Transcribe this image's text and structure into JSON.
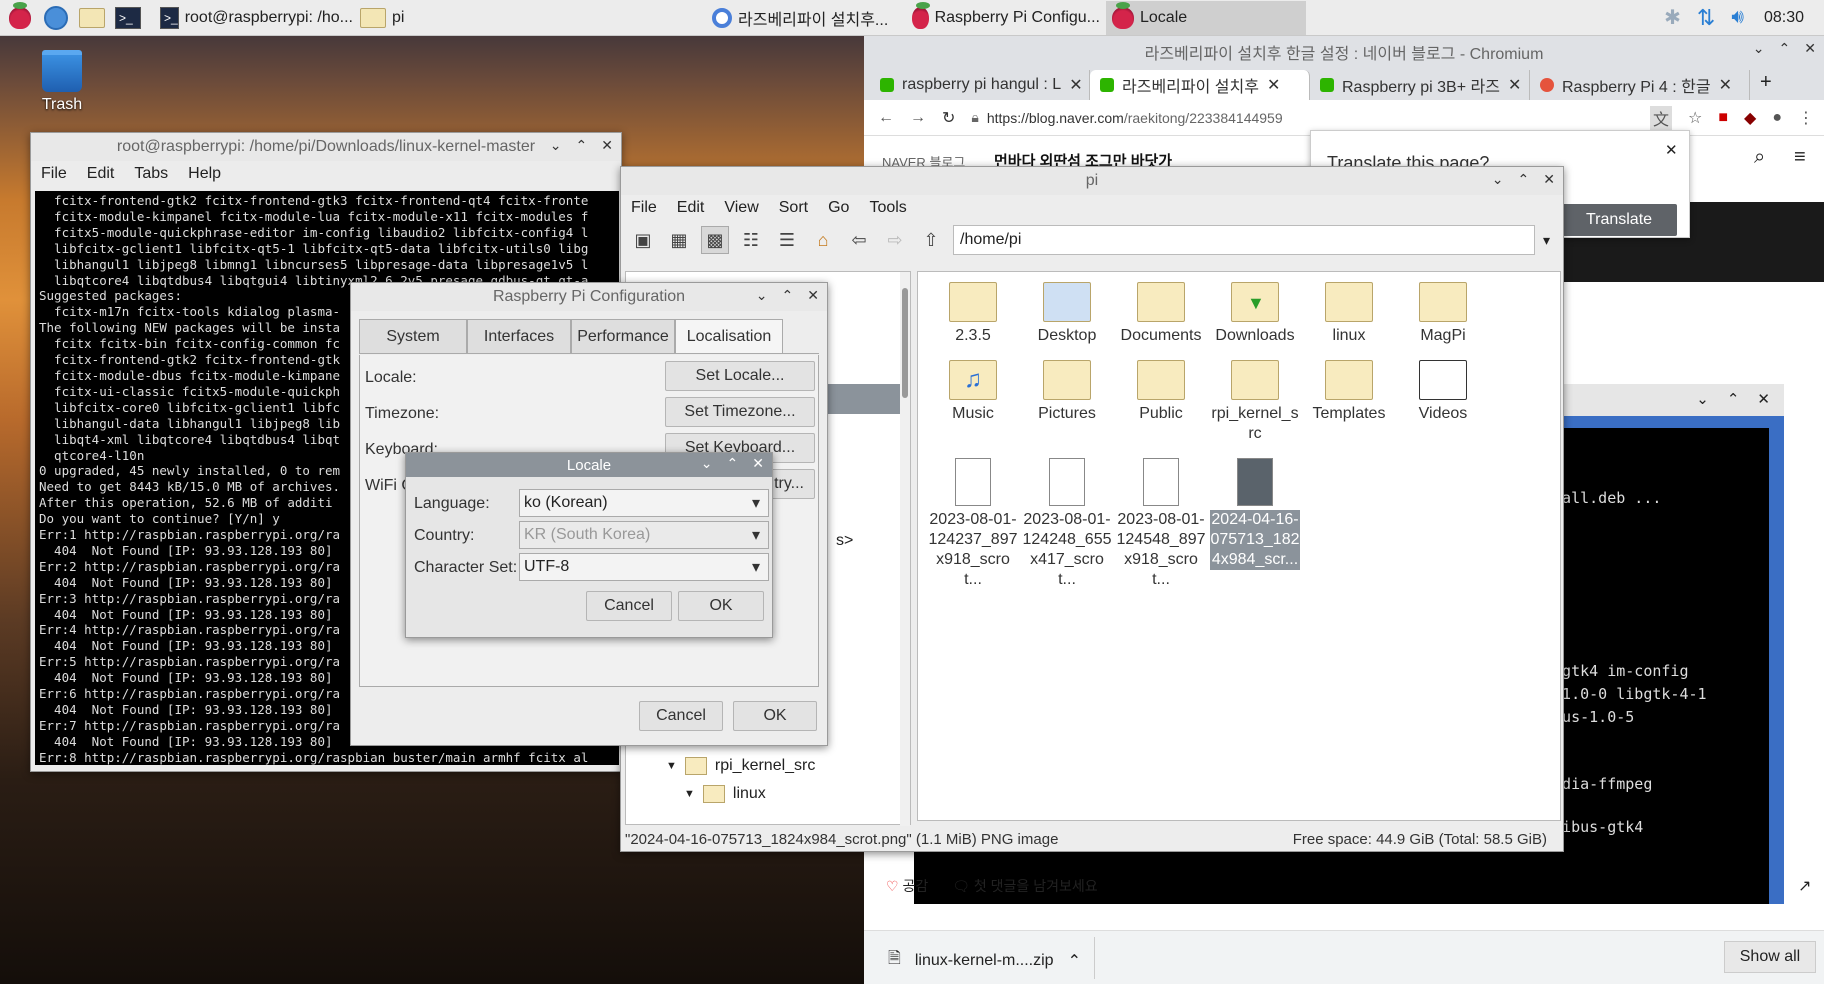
{
  "taskbar": {
    "terminal_btn": "root@raspberrypi: /ho...",
    "folder_btn": "pi",
    "chromium_btn": "라즈베리파이 설치후...",
    "config_btn": "Raspberry Pi Configu...",
    "locale_btn": "Locale",
    "clock": "08:30"
  },
  "desktop": {
    "trash_label": "Trash"
  },
  "terminal": {
    "title": "root@raspberrypi: /home/pi/Downloads/linux-kernel-master",
    "menu": [
      "File",
      "Edit",
      "Tabs",
      "Help"
    ],
    "lines": [
      "  fcitx-frontend-gtk2 fcitx-frontend-gtk3 fcitx-frontend-qt4 fcitx-fronte",
      "  fcitx-module-kimpanel fcitx-module-lua fcitx-module-x11 fcitx-modules f",
      "  fcitx5-module-quickphrase-editor im-config libaudio2 libfcitx-config4 l",
      "  libfcitx-gclient1 libfcitx-qt5-1 libfcitx-qt5-data libfcitx-utils0 libg",
      "  libhangul1 libjpeg8 libmng1 libncurses5 libpresage-data libpresage1v5 l",
      "  libqtcore4 libqtdbus4 libqtgui4 libtinyxml2.6.2v5 presage qdbus-qt qt-a",
      "Suggested packages:",
      "  fcitx-m17n fcitx-tools kdialog plasma-",
      "The following NEW packages will be insta",
      "  fcitx fcitx-bin fcitx-config-common fc",
      "  fcitx-frontend-gtk2 fcitx-frontend-gtk",
      "  fcitx-module-dbus fcitx-module-kimpane",
      "  fcitx-ui-classic fcitx5-module-quickph",
      "  libfcitx-core0 libfcitx-gclient1 libfc",
      "  libhangul-data libhangul1 libjpeg8 lib",
      "  libqt4-xml libqtcore4 libqtdbus4 libqt",
      "  qtcore4-l10n",
      "0 upgraded, 45 newly installed, 0 to rem",
      "Need to get 8443 kB/15.0 MB of archives.",
      "After this operation, 52.6 MB of additi",
      "Do you want to continue? [Y/n] y",
      "Err:1 http://raspbian.raspberrypi.org/ra",
      "  404  Not Found [IP: 93.93.128.193 80]",
      "Err:2 http://raspbian.raspberrypi.org/ra",
      "  404  Not Found [IP: 93.93.128.193 80]",
      "Err:3 http://raspbian.raspberrypi.org/ra",
      "  404  Not Found [IP: 93.93.128.193 80]",
      "Err:4 http://raspbian.raspberrypi.org/ra",
      "  404  Not Found [IP: 93.93.128.193 80]",
      "Err:5 http://raspbian.raspberrypi.org/ra",
      "  404  Not Found [IP: 93.93.128.193 80]",
      "Err:6 http://raspbian.raspberrypi.org/ra",
      "  404  Not Found [IP: 93.93.128.193 80]",
      "Err:7 http://raspbian.raspberrypi.org/ra",
      "  404  Not Found [IP: 93.93.128.193 80]",
      "Err:8 http://raspbian.raspberrypi.org/raspbian buster/main armhf fcitx al"
    ]
  },
  "chromium": {
    "title": "라즈베리파이 설치후 한글 설정 : 네이버 블로그 - Chromium",
    "tabs": [
      "raspberry pi hangul : L",
      "라즈베리파이 설치후",
      "Raspberry pi 3B+ 라즈",
      "Raspberry Pi 4 : 한글"
    ],
    "url_host": "https://blog.naver.com",
    "url_path": "/raekitong/223384144959",
    "naver_label": "NAVER 블로그",
    "blog_header": "먼바다 외딴섬 조그만 바닷가",
    "translate_title": "Translate this page?",
    "translate_btn": "Translate",
    "like_label": "공감",
    "comment_label": "첫 댓글을 남겨보세요",
    "download_file": "linux-kernel-m....zip",
    "show_all": "Show all",
    "bg_terminal_lines": [
      ".)",
      "8_all.deb ...",
      "s-gtk4 im-config",
      "e-1.0-0 libgtk-4-1",
      "ibus-1.0-5",
      "media-ffmpeg",
      "3 ibus-gtk4"
    ]
  },
  "filemanager": {
    "title": "pi",
    "menu": [
      "File",
      "Edit",
      "View",
      "Sort",
      "Go",
      "Tools"
    ],
    "path": "/home/pi",
    "tree": [
      "rpi_kernel_src",
      "linux"
    ],
    "tree_partial": "s>",
    "folders": [
      "2.3.5",
      "Desktop",
      "Documents",
      "Downloads",
      "linux",
      "MagPi",
      "Music",
      "Pictures",
      "Public",
      "rpi_kernel_src",
      "Templates",
      "Videos"
    ],
    "files": [
      {
        "name": "2023-08-01-124237_897x918_scrot..."
      },
      {
        "name": "2023-08-01-124248_655x417_scrot..."
      },
      {
        "name": "2023-08-01-124548_897x918_scrot..."
      },
      {
        "name": "2024-04-16-075713_1824x984_scr..."
      }
    ],
    "status_left": "\"2024-04-16-075713_1824x984_scrot.png\" (1.1 MiB) PNG image",
    "status_right": "Free space: 44.9 GiB (Total: 58.5 GiB)"
  },
  "config": {
    "title": "Raspberry Pi Configuration",
    "tabs": [
      "System",
      "Interfaces",
      "Performance",
      "Localisation"
    ],
    "locale_label": "Locale:",
    "timezone_label": "Timezone:",
    "keyboard_label": "Keyboard:",
    "wifi_label": "WiFi C",
    "set_locale": "Set Locale...",
    "set_timezone": "Set Timezone...",
    "set_keyboard": "Set Keyboard...",
    "set_wifi": "try...",
    "cancel": "Cancel",
    "ok": "OK"
  },
  "locale_dialog": {
    "title": "Locale",
    "language_label": "Language:",
    "language_value": "ko (Korean)",
    "country_label": "Country:",
    "country_value": "KR (South Korea)",
    "charset_label": "Character Set:",
    "charset_value": "UTF-8",
    "cancel": "Cancel",
    "ok": "OK"
  }
}
